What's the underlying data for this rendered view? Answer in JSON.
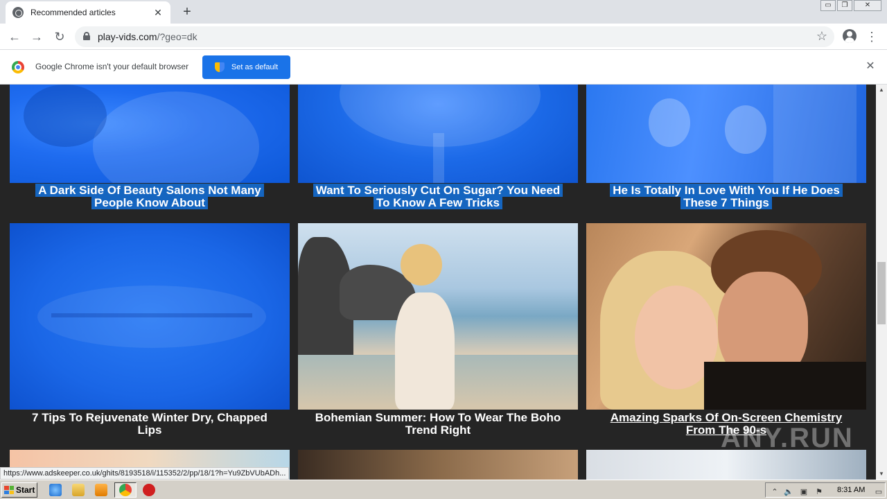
{
  "tab": {
    "title": "Recommended articles",
    "close_glyph": "✕",
    "favicon": "globe-icon"
  },
  "new_tab_glyph": "+",
  "window_controls": {
    "minimize": "▭",
    "restore": "❐",
    "close": "✕"
  },
  "toolbar": {
    "back": "←",
    "forward": "→",
    "reload": "↻",
    "url_host": "play-vids.com",
    "url_path": "/?geo=dk",
    "star": "☆",
    "menu": "⋮"
  },
  "infobar": {
    "message": "Google Chrome isn't your default browser",
    "button_label": "Set as default",
    "close_glyph": "✕"
  },
  "articles": [
    {
      "title_line1": "A Dark Side Of Beauty Salons Not Many",
      "title_line2": "People Know About"
    },
    {
      "title_line1": "Want To Seriously Cut On Sugar? You Need",
      "title_line2": "To Know A Few Tricks"
    },
    {
      "title_line1": "He Is Totally In Love With You If He Does",
      "title_line2": "These 7 Things"
    },
    {
      "title_line1": "7 Tips To Rejuvenate Winter Dry, Chapped",
      "title_line2": "Lips"
    },
    {
      "title_line1": "Bohemian Summer: How To Wear The Boho",
      "title_line2": "Trend Right"
    },
    {
      "title_line1": "Amazing Sparks Of On-Screen Chemistry",
      "title_line2": "From The 90-s"
    }
  ],
  "watermark": "ANY.RUN",
  "status_url": "https://www.adskeeper.co.uk/ghits/8193518/i/115352/2/pp/18/1?h=Yu9ZbVUbADh...",
  "scrollbar": {
    "up": "▲",
    "down": "▼"
  },
  "taskbar": {
    "start_label": "Start",
    "clock": "8:31 AM"
  },
  "colors": {
    "selection_blue": "#1565c0",
    "card_background": "#252525",
    "primary_button": "#1a73e8"
  }
}
